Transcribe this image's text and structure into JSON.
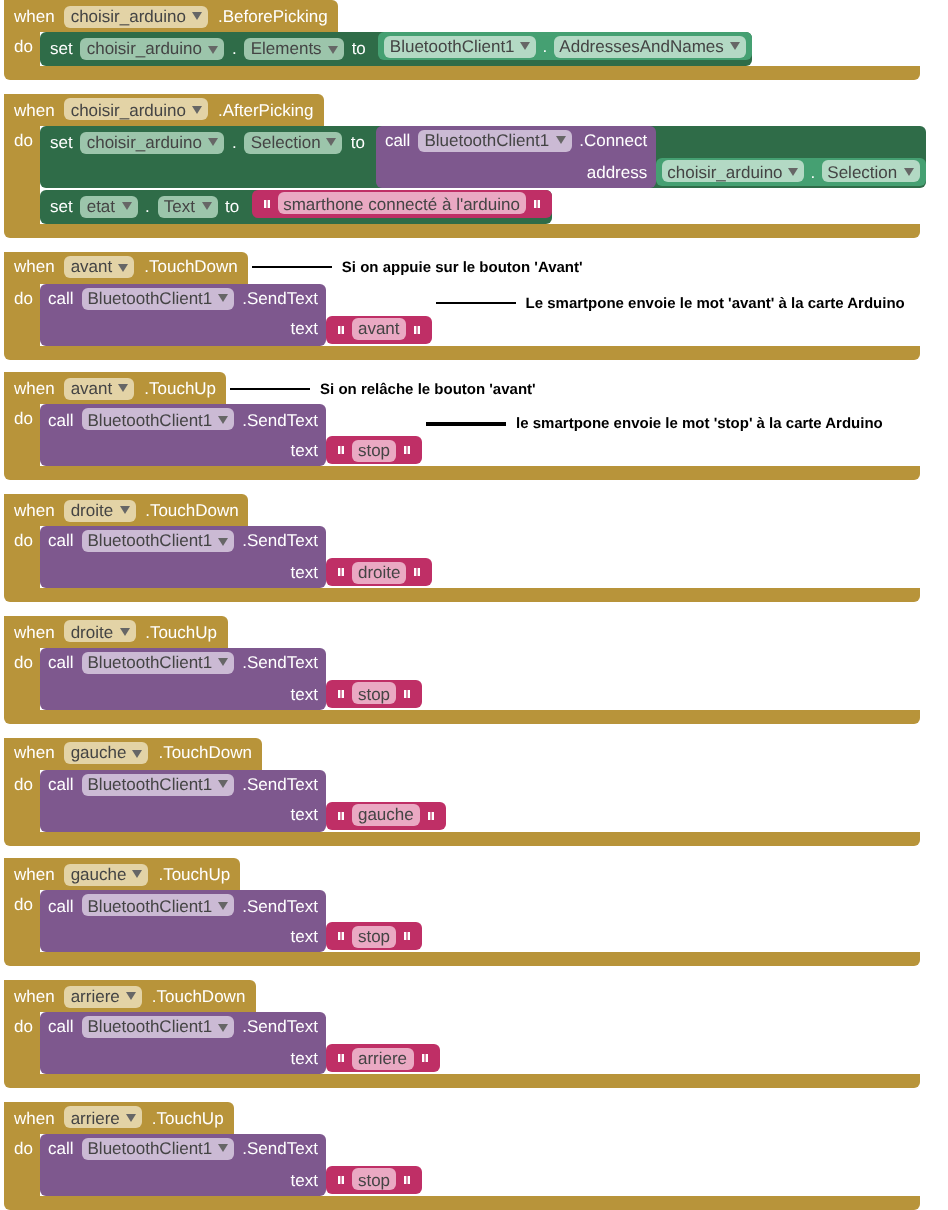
{
  "events": [
    {
      "when": "when",
      "component": "choisir_arduino",
      "event": ".BeforePicking",
      "do": "do",
      "statements": [
        {
          "kind": "set",
          "set": "set",
          "component": "choisir_arduino",
          "dot": ".",
          "property": "Elements",
          "to": "to",
          "value": {
            "kind": "getter",
            "component": "BluetoothClient1",
            "dot": ".",
            "property": "AddressesAndNames"
          }
        }
      ]
    },
    {
      "when": "when",
      "component": "choisir_arduino",
      "event": ".AfterPicking",
      "do": "do",
      "statements": [
        {
          "kind": "set",
          "set": "set",
          "component": "choisir_arduino",
          "dot": ".",
          "property": "Selection",
          "to": "to",
          "value": {
            "kind": "call",
            "call": "call",
            "component": "BluetoothClient1",
            "method": ".Connect",
            "arg_name": "address",
            "arg": {
              "kind": "getter",
              "component": "choisir_arduino",
              "dot": ".",
              "property": "Selection"
            }
          }
        },
        {
          "kind": "set",
          "set": "set",
          "component": "etat",
          "dot": ".",
          "property": "Text",
          "to": "to",
          "value": {
            "kind": "string",
            "text": "smarthone connecté à l'arduino"
          }
        }
      ]
    },
    {
      "when": "when",
      "component": "avant",
      "event": ".TouchDown",
      "do": "do",
      "comment": "Si on appuie sur le bouton 'Avant'",
      "statements": [
        {
          "kind": "call",
          "call": "call",
          "component": "BluetoothClient1",
          "method": ".SendText",
          "arg_name": "text",
          "arg": {
            "kind": "string",
            "text": "avant"
          },
          "comment": "Le smartpone envoie le mot 'avant' à la carte Arduino"
        }
      ]
    },
    {
      "when": "when",
      "component": "avant",
      "event": ".TouchUp",
      "do": "do",
      "comment": "Si on relâche le bouton 'avant'",
      "statements": [
        {
          "kind": "call",
          "call": "call",
          "component": "BluetoothClient1",
          "method": ".SendText",
          "arg_name": "text",
          "arg": {
            "kind": "string",
            "text": "stop"
          },
          "comment": "le smartpone envoie le mot 'stop' à la carte Arduino"
        }
      ]
    },
    {
      "when": "when",
      "component": "droite",
      "event": ".TouchDown",
      "do": "do",
      "statements": [
        {
          "kind": "call",
          "call": "call",
          "component": "BluetoothClient1",
          "method": ".SendText",
          "arg_name": "text",
          "arg": {
            "kind": "string",
            "text": "droite"
          }
        }
      ]
    },
    {
      "when": "when",
      "component": "droite",
      "event": ".TouchUp",
      "do": "do",
      "statements": [
        {
          "kind": "call",
          "call": "call",
          "component": "BluetoothClient1",
          "method": ".SendText",
          "arg_name": "text",
          "arg": {
            "kind": "string",
            "text": "stop"
          }
        }
      ]
    },
    {
      "when": "when",
      "component": "gauche",
      "event": ".TouchDown",
      "do": "do",
      "statements": [
        {
          "kind": "call",
          "call": "call",
          "component": "BluetoothClient1",
          "method": ".SendText",
          "arg_name": "text",
          "arg": {
            "kind": "string",
            "text": "gauche"
          }
        }
      ]
    },
    {
      "when": "when",
      "component": "gauche",
      "event": ".TouchUp",
      "do": "do",
      "statements": [
        {
          "kind": "call",
          "call": "call",
          "component": "BluetoothClient1",
          "method": ".SendText",
          "arg_name": "text",
          "arg": {
            "kind": "string",
            "text": "stop"
          }
        }
      ]
    },
    {
      "when": "when",
      "component": "arriere",
      "event": ".TouchDown",
      "do": "do",
      "statements": [
        {
          "kind": "call",
          "call": "call",
          "component": "BluetoothClient1",
          "method": ".SendText",
          "arg_name": "text",
          "arg": {
            "kind": "string",
            "text": "arriere"
          }
        }
      ]
    },
    {
      "when": "when",
      "component": "arriere",
      "event": ".TouchUp",
      "do": "do",
      "statements": [
        {
          "kind": "call",
          "call": "call",
          "component": "BluetoothClient1",
          "method": ".SendText",
          "arg_name": "text",
          "arg": {
            "kind": "string",
            "text": "stop"
          }
        }
      ]
    }
  ]
}
